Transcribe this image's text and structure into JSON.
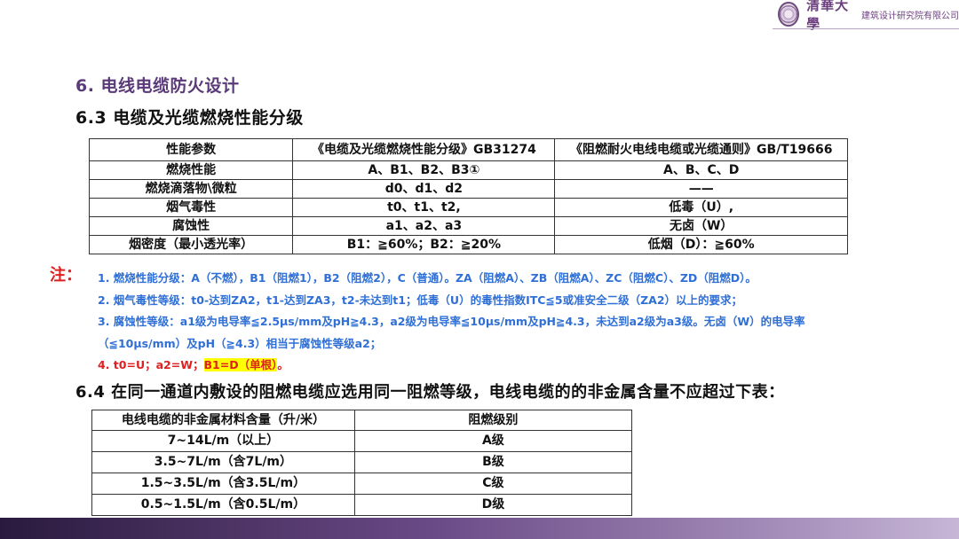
{
  "header": {
    "logo_script": "清華大學",
    "logo_text": "建筑设计研究院有限公司"
  },
  "titles": {
    "main": "6. 电线电缆防火设计",
    "sec1": "6.3 电缆及光缆燃烧性能分级",
    "sec2": "6.4 在同一通道内敷设的阻燃电缆应选用同一阻燃等级，电线电缆的的非金属含量不应超过下表："
  },
  "table1": {
    "headers": [
      "性能参数",
      "《电缆及光缆燃烧性能分级》GB31274",
      "《阻燃耐火电线电缆或光缆通则》GB/T19666"
    ],
    "rows": [
      [
        "燃烧性能",
        "A、B1、B2、B3①",
        "A、B、C、D"
      ],
      [
        "燃烧滴落物\\微粒",
        "d0、d1、d2",
        "——"
      ],
      [
        "烟气毒性",
        "t0、t1、t2,",
        "低毒（U）,"
      ],
      [
        "腐蚀性",
        "a1、a2、a3",
        "无卤（W）"
      ],
      [
        "烟密度（最小透光率）",
        "B1：≧60%；B2：≧20%",
        "低烟（D）：≧60%"
      ]
    ]
  },
  "notes": {
    "label": "注：",
    "items": [
      "1. 燃烧性能分级：A（不燃），B1（阻燃1），B2（阻燃2），C（普通）。ZA（阻燃A）、ZB（阻燃A）、ZC（阻燃C）、ZD（阻燃D）。",
      "2. 烟气毒性等级：t0-达到ZA2，t1-达到ZA3，t2-未达到t1；低毒（U）的毒性指数ITC≦5或准安全二级（ZA2）以上的要求；",
      "3. 腐蚀性等级：a1级为电导率≦2.5μs/mm及pH≧4.3，a2级为电导率≦10μs/mm及pH≧4.3，未达到a2级为a3级。无卤（W）的电导率",
      "（≦10μs/mm）及pH（≧4.3）相当于腐蚀性等级a2；"
    ],
    "item4_prefix": "4. t0=U；a2=W；",
    "item4_highlight": "B1=D（单根）",
    "item4_suffix": "。"
  },
  "table2": {
    "headers": [
      "电线电缆的非金属材料含量（升/米）",
      "阻燃级别"
    ],
    "rows": [
      [
        "7~14L/m（以上）",
        "A级"
      ],
      [
        "3.5~7L/m（含7L/m）",
        "B级"
      ],
      [
        "1.5~3.5L/m（含3.5L/m）",
        "C级"
      ],
      [
        "0.5~1.5L/m（含0.5L/m）",
        "D级"
      ]
    ]
  }
}
